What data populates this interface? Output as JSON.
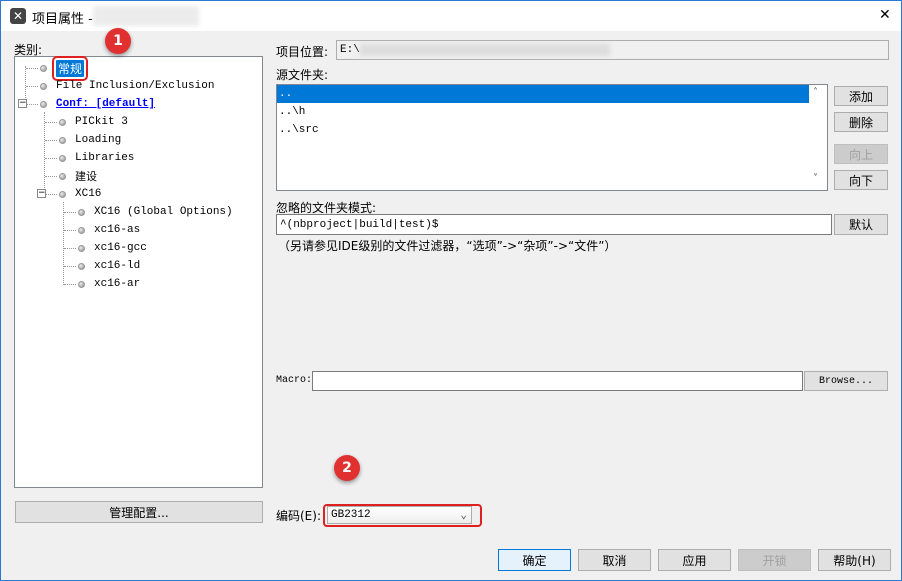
{
  "window": {
    "title": "项目属性 -",
    "close": "✕"
  },
  "categories_label": "类别:",
  "tree": [
    {
      "label": "常规",
      "level": 0,
      "selected": true
    },
    {
      "label": "File Inclusion/Exclusion",
      "level": 0
    },
    {
      "label": "Conf: [default]",
      "level": 0,
      "link": true
    },
    {
      "label": "PICkit 3",
      "level": 1
    },
    {
      "label": "Loading",
      "level": 1
    },
    {
      "label": "Libraries",
      "level": 1
    },
    {
      "label": "建设",
      "level": 1
    },
    {
      "label": "XC16",
      "level": 1
    },
    {
      "label": "XC16 (Global Options)",
      "level": 2
    },
    {
      "label": "xc16-as",
      "level": 2
    },
    {
      "label": "xc16-gcc",
      "level": 2
    },
    {
      "label": "xc16-ld",
      "level": 2
    },
    {
      "label": "xc16-ar",
      "level": 2
    }
  ],
  "manage_config_button": "管理配置...",
  "project_location": {
    "label": "项目位置:",
    "value": "E:\\"
  },
  "source_folders": {
    "label": "源文件夹:",
    "items": [
      "..",
      "..\\h",
      "..\\src"
    ]
  },
  "folder_buttons": {
    "add": "添加",
    "remove": "删除",
    "up": "向上",
    "down": "向下"
  },
  "ignored": {
    "label": "忽略的文件夹模式:",
    "value": "^(nbproject|build|test)$",
    "default_button": "默认",
    "note": "（另请参见IDE级别的文件过滤器，“选项”->“杂项”->“文件”）"
  },
  "macro": {
    "label": "Macro:",
    "value": "",
    "browse": "Browse..."
  },
  "encoding": {
    "label": "编码(E):",
    "value": "GB2312"
  },
  "footer": {
    "ok": "确定",
    "cancel": "取消",
    "apply": "应用",
    "unlock": "开锁",
    "help": "帮助(H)"
  },
  "annotations": [
    "1",
    "2"
  ],
  "colors": {
    "selection": "#0078d7",
    "annotation": "#e03030"
  }
}
